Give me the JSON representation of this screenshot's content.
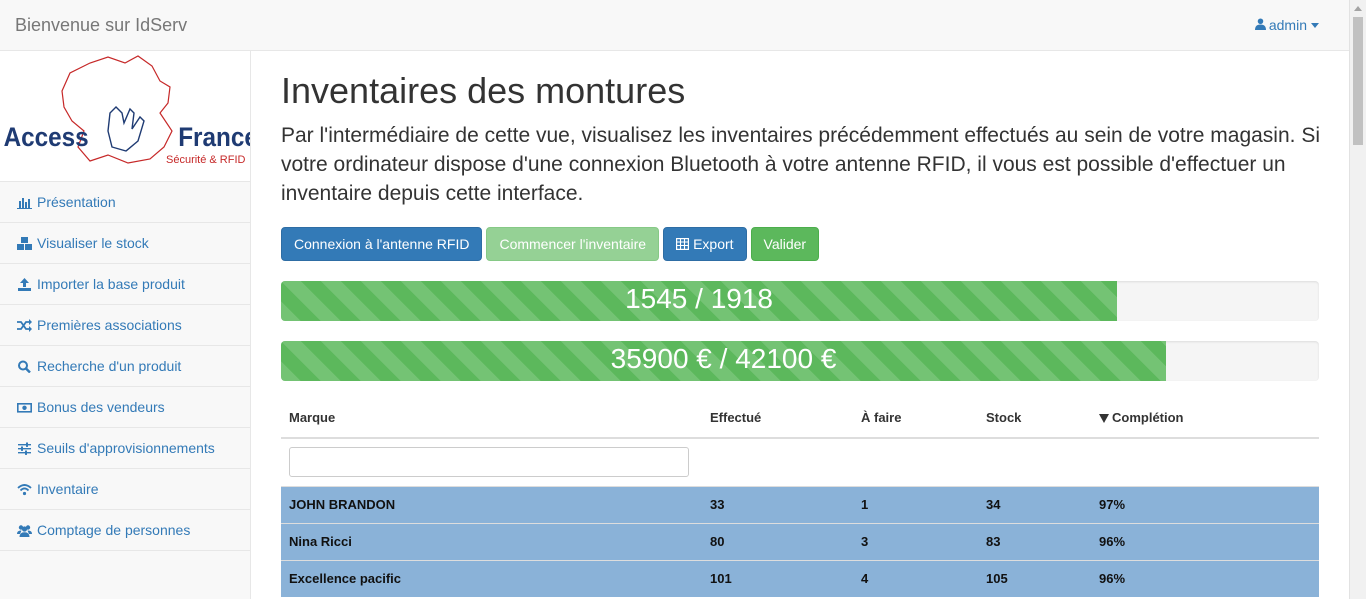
{
  "topbar": {
    "brand": "Bienvenue sur IdServ",
    "user": "admin"
  },
  "logo": {
    "name_left": "Access",
    "name_right": "France",
    "tagline": "Sécurité & RFID"
  },
  "sidebar": {
    "items": [
      {
        "label": "Présentation",
        "icon": "bar-chart-icon"
      },
      {
        "label": "Visualiser le stock",
        "icon": "boxes-icon"
      },
      {
        "label": "Importer la base produit",
        "icon": "upload-icon"
      },
      {
        "label": "Premières associations",
        "icon": "shuffle-icon"
      },
      {
        "label": "Recherche d'un produit",
        "icon": "search-icon"
      },
      {
        "label": "Bonus des vendeurs",
        "icon": "money-icon"
      },
      {
        "label": "Seuils d'approvisionnements",
        "icon": "sliders-icon"
      },
      {
        "label": "Inventaire",
        "icon": "wifi-icon"
      },
      {
        "label": "Comptage de personnes",
        "icon": "users-icon"
      }
    ]
  },
  "main": {
    "title": "Inventaires des montures",
    "lead": "Par l'intermédiaire de cette vue, visualisez les inventaires précédemment effectués au sein de votre magasin. Si votre ordinateur dispose d'une connexion Bluetooth à votre antenne RFID, il vous est possible d'effectuer un inventaire depuis cette interface.",
    "buttons": {
      "connect": "Connexion à l'antenne RFID",
      "start": "Commencer l'inventaire",
      "export": "Export",
      "validate": "Valider"
    },
    "progress": [
      {
        "label": "1545 / 1918",
        "fraction": 0.8055
      },
      {
        "label": "35900 € / 42100 €",
        "fraction": 0.8527
      }
    ],
    "table": {
      "headers": [
        "Marque",
        "Effectué",
        "À faire",
        "Stock",
        "Complétion"
      ],
      "filter_value": "",
      "rows": [
        [
          "JOHN BRANDON",
          "33",
          "1",
          "34",
          "97%"
        ],
        [
          "Nina Ricci",
          "80",
          "3",
          "83",
          "96%"
        ],
        [
          "Excellence pacific",
          "101",
          "4",
          "105",
          "96%"
        ]
      ]
    }
  },
  "colors": {
    "primary": "#337ab7",
    "success": "#5cb85c",
    "row_highlight": "#8ab2d8"
  }
}
